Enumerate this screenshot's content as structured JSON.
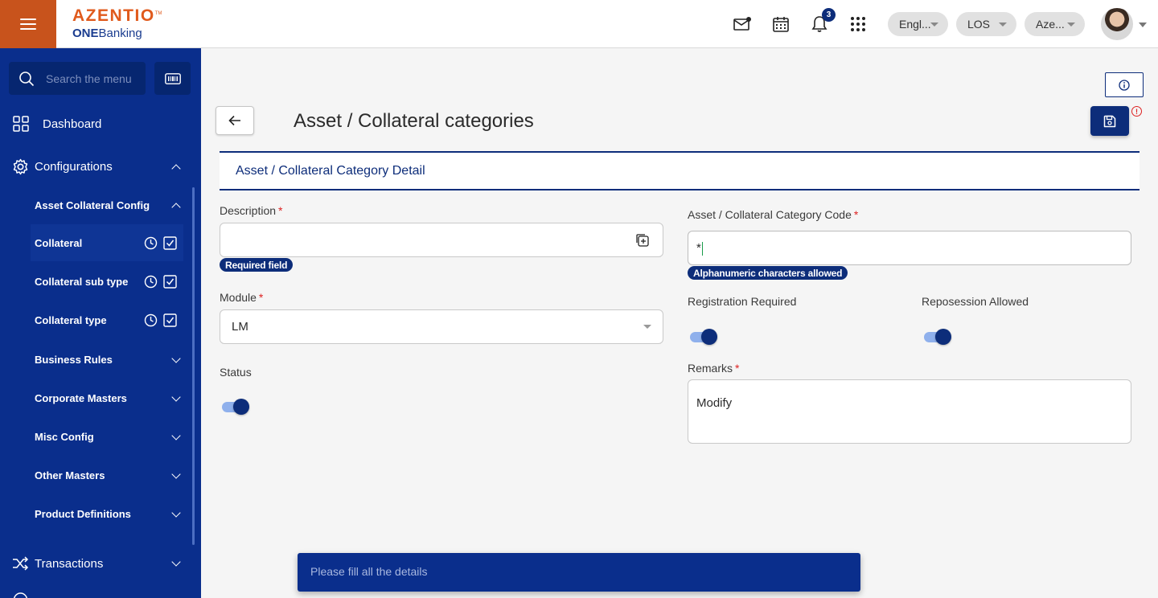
{
  "header": {
    "brand": "AZENTIO",
    "brand_tm": "TM",
    "sub_brand_bold": "ONE",
    "sub_brand_rest": "Banking",
    "notification_count": "3",
    "language": "Engl...",
    "module": "LOS",
    "entity": "Aze..."
  },
  "sidebar": {
    "search_placeholder": "Search the menu",
    "dashboard": "Dashboard",
    "configurations": "Configurations",
    "asset_collateral_config": "Asset Collateral Config",
    "items": [
      {
        "label": "Collateral",
        "active": true
      },
      {
        "label": "Collateral sub type",
        "active": false
      },
      {
        "label": "Collateral type",
        "active": false
      }
    ],
    "groups": [
      "Business Rules",
      "Corporate Masters",
      "Misc Config",
      "Other Masters",
      "Product Definitions"
    ],
    "transactions": "Transactions"
  },
  "page": {
    "title": "Asset / Collateral categories",
    "section_title": "Asset / Collateral Category Detail"
  },
  "form": {
    "description": {
      "label": "Description",
      "required_mark": "*",
      "value": "",
      "hint": "Required field"
    },
    "code": {
      "label": "Asset / Collateral Category Code",
      "required_mark": "*",
      "value": "*",
      "hint": "Alphanumeric characters allowed"
    },
    "module": {
      "label": "Module",
      "required_mark": "*",
      "value": "LM"
    },
    "registration_required": {
      "label": "Registration Required",
      "on": true
    },
    "reposession_allowed": {
      "label": "Reposession Allowed",
      "on": true
    },
    "status": {
      "label": "Status",
      "on": true
    },
    "remarks": {
      "label": "Remarks",
      "required_mark": "*",
      "value": "Modify"
    }
  },
  "toast": {
    "message": "Please fill all the details"
  },
  "colors": {
    "primary": "#0d2d7a",
    "sidebar": "#0a2e8c",
    "accent": "#c8531c",
    "required": "#dd2222"
  }
}
